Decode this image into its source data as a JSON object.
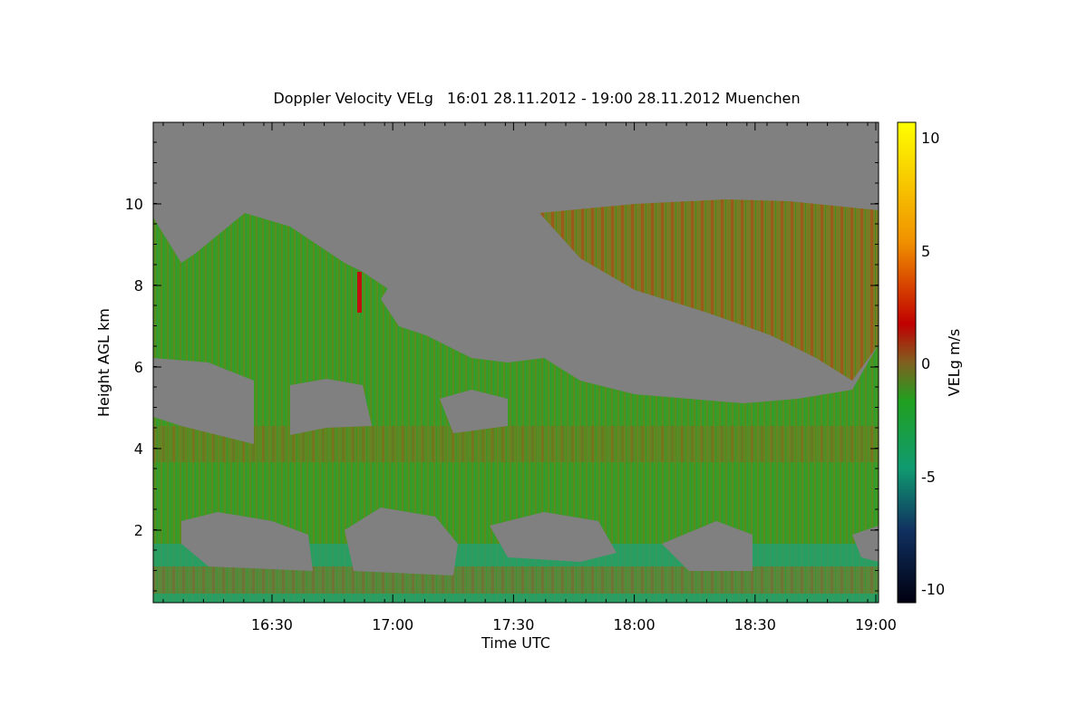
{
  "chart_title": "Doppler Velocity VELg   16:01 28.11.2012 - 19:00 28.11.2012 Muenchen",
  "x_axis": {
    "label": "Time UTC",
    "ticks": [
      "16:30",
      "17:00",
      "17:30",
      "18:00",
      "18:30",
      "19:00"
    ]
  },
  "y_axis": {
    "label": "Height AGL km",
    "ticks": [
      "10",
      "8",
      "6",
      "4",
      "2"
    ]
  },
  "colorbar": {
    "label": "VELg m/s",
    "ticks": [
      "10",
      "5",
      "0",
      "-5",
      "-10"
    ]
  }
}
